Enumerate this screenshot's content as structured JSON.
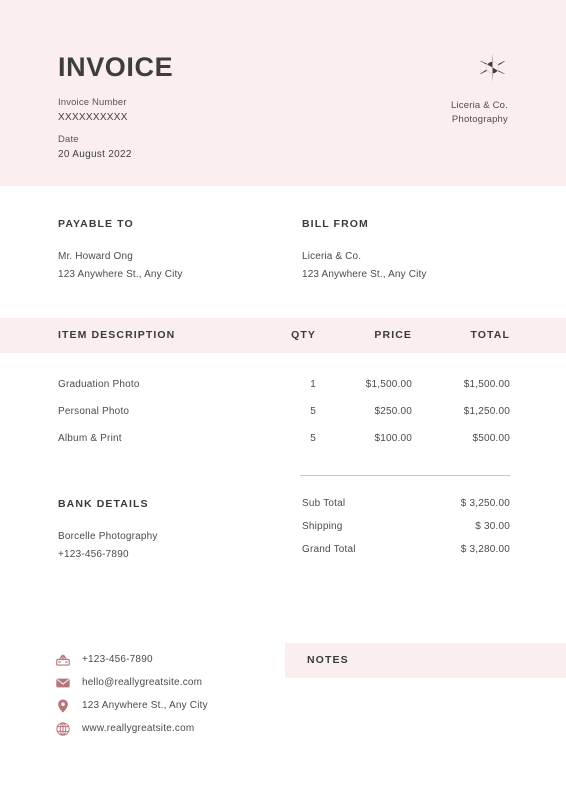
{
  "document": {
    "title": "INVOICE",
    "colors": {
      "blush_band": "#faeeee",
      "page_background": "#ffffff",
      "heading_text": "#3a3a3c",
      "body_text": "#4b4a4e",
      "icon_accent": "#b4757b",
      "logo_mark": "#3d3d3d",
      "divider": "#c9c9c9"
    }
  },
  "header": {
    "title": "INVOICE",
    "invoice_number_label": "Invoice Number",
    "invoice_number_value": "XXXXXXXXXX",
    "date_label": "Date",
    "date_value": "20 August 2022",
    "logo": {
      "icon": "camera-aperture-icon",
      "line1": "Liceria & Co.",
      "line2": "Photography"
    }
  },
  "parties": {
    "payable_to": {
      "heading": "PAYABLE TO",
      "name": "Mr. Howard Ong",
      "address": "123 Anywhere St., Any City"
    },
    "bill_from": {
      "heading": "BILL FROM",
      "name": "Liceria & Co.",
      "address": "123 Anywhere St., Any City"
    }
  },
  "table": {
    "columns": {
      "description": "ITEM DESCRIPTION",
      "qty": "QTY",
      "price": "PRICE",
      "total": "TOTAL"
    },
    "rows": [
      {
        "description": "Graduation Photo",
        "qty": "1",
        "price": "$1,500.00",
        "total": "$1,500.00"
      },
      {
        "description": "Personal Photo",
        "qty": "5",
        "price": "$250.00",
        "total": "$1,250.00"
      },
      {
        "description": "Album & Print",
        "qty": "5",
        "price": "$100.00",
        "total": "$500.00"
      }
    ]
  },
  "bank_details": {
    "heading": "BANK DETAILS",
    "line1": "Borcelle Photography",
    "line2": "+123-456-7890"
  },
  "totals": {
    "rows": [
      {
        "label": "Sub Total",
        "value": "$ 3,250.00"
      },
      {
        "label": "Shipping",
        "value": "$ 30.00"
      },
      {
        "label": "Grand Total",
        "value": "$ 3,280.00"
      }
    ]
  },
  "notes": {
    "heading": "NOTES",
    "body": ""
  },
  "contacts": [
    {
      "icon": "telephone-icon",
      "text": "+123-456-7890"
    },
    {
      "icon": "envelope-icon",
      "text": "hello@reallygreatsite.com"
    },
    {
      "icon": "location-pin-icon",
      "text": "123 Anywhere St., Any City"
    },
    {
      "icon": "globe-icon",
      "text": "www.reallygreatsite.com"
    }
  ]
}
